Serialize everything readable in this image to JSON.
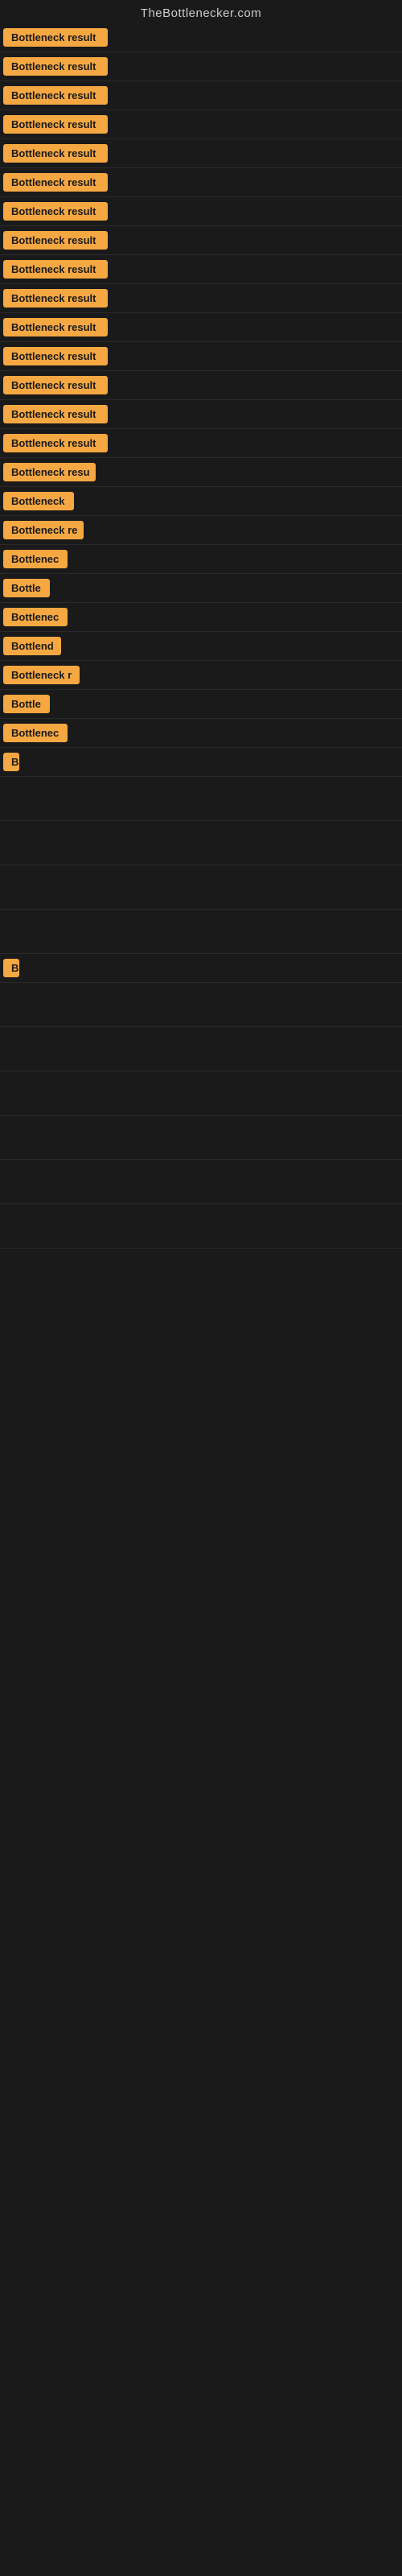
{
  "site": {
    "title": "TheBottlenecker.com"
  },
  "rows": [
    {
      "id": 1,
      "label": "Bottleneck result",
      "width": 130
    },
    {
      "id": 2,
      "label": "Bottleneck result",
      "width": 130
    },
    {
      "id": 3,
      "label": "Bottleneck result",
      "width": 130
    },
    {
      "id": 4,
      "label": "Bottleneck result",
      "width": 130
    },
    {
      "id": 5,
      "label": "Bottleneck result",
      "width": 130
    },
    {
      "id": 6,
      "label": "Bottleneck result",
      "width": 130
    },
    {
      "id": 7,
      "label": "Bottleneck result",
      "width": 130
    },
    {
      "id": 8,
      "label": "Bottleneck result",
      "width": 130
    },
    {
      "id": 9,
      "label": "Bottleneck result",
      "width": 130
    },
    {
      "id": 10,
      "label": "Bottleneck result",
      "width": 130
    },
    {
      "id": 11,
      "label": "Bottleneck result",
      "width": 130
    },
    {
      "id": 12,
      "label": "Bottleneck result",
      "width": 130
    },
    {
      "id": 13,
      "label": "Bottleneck result",
      "width": 130
    },
    {
      "id": 14,
      "label": "Bottleneck result",
      "width": 130
    },
    {
      "id": 15,
      "label": "Bottleneck result",
      "width": 130
    },
    {
      "id": 16,
      "label": "Bottleneck resu",
      "width": 115
    },
    {
      "id": 17,
      "label": "Bottleneck",
      "width": 88
    },
    {
      "id": 18,
      "label": "Bottleneck re",
      "width": 100
    },
    {
      "id": 19,
      "label": "Bottlenec",
      "width": 80
    },
    {
      "id": 20,
      "label": "Bottle",
      "width": 58
    },
    {
      "id": 21,
      "label": "Bottlenec",
      "width": 80
    },
    {
      "id": 22,
      "label": "Bottlend",
      "width": 72
    },
    {
      "id": 23,
      "label": "Bottleneck r",
      "width": 95
    },
    {
      "id": 24,
      "label": "Bottle",
      "width": 58
    },
    {
      "id": 25,
      "label": "Bottlenec",
      "width": 80
    },
    {
      "id": 26,
      "label": "B",
      "width": 18
    },
    {
      "id": 27,
      "label": "",
      "width": 0
    },
    {
      "id": 28,
      "label": "",
      "width": 0
    },
    {
      "id": 29,
      "label": "",
      "width": 0
    },
    {
      "id": 30,
      "label": "",
      "width": 0
    },
    {
      "id": 31,
      "label": "B",
      "width": 18
    },
    {
      "id": 32,
      "label": "",
      "width": 0
    },
    {
      "id": 33,
      "label": "",
      "width": 0
    },
    {
      "id": 34,
      "label": "",
      "width": 0
    },
    {
      "id": 35,
      "label": "",
      "width": 0
    },
    {
      "id": 36,
      "label": "",
      "width": 0
    },
    {
      "id": 37,
      "label": "",
      "width": 0
    }
  ]
}
